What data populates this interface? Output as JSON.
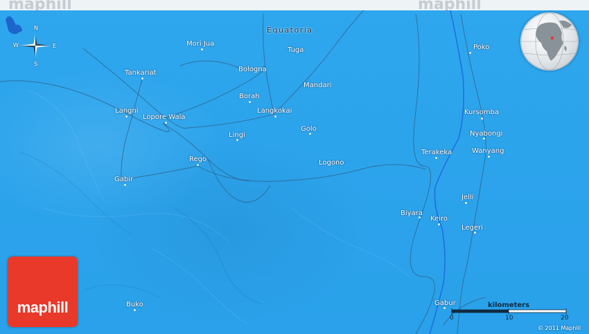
{
  "brand": {
    "name": "maphill"
  },
  "region_label": "Equatoria",
  "places": [
    {
      "name": "Mori Jua"
    },
    {
      "name": "Tuga"
    },
    {
      "name": "Tankariat"
    },
    {
      "name": "Bologna"
    },
    {
      "name": "Mandari"
    },
    {
      "name": "Borah"
    },
    {
      "name": "Langni"
    },
    {
      "name": "Lopore Wala"
    },
    {
      "name": "Langkokai"
    },
    {
      "name": "Golo"
    },
    {
      "name": "Lingi"
    },
    {
      "name": "Rego"
    },
    {
      "name": "Logono"
    },
    {
      "name": "Gabir"
    },
    {
      "name": "Poko"
    },
    {
      "name": "Kursomba"
    },
    {
      "name": "Nyabongi"
    },
    {
      "name": "Terakeka"
    },
    {
      "name": "Wanyang"
    },
    {
      "name": "Jelli"
    },
    {
      "name": "Biyara"
    },
    {
      "name": "Keiro"
    },
    {
      "name": "Legeri"
    },
    {
      "name": "Buko"
    },
    {
      "name": "Gabur"
    }
  ],
  "compass": {
    "n": "N",
    "s": "S",
    "e": "E",
    "w": "W"
  },
  "scale": {
    "title": "kilometers",
    "ticks": [
      "0",
      "10",
      "20"
    ]
  },
  "copyright": "© 2011 Maphill",
  "colors": {
    "land": "#2ca4ec",
    "river": "#1f6fe0",
    "logo": "#e8392a",
    "top_band": "#eef3f6"
  }
}
